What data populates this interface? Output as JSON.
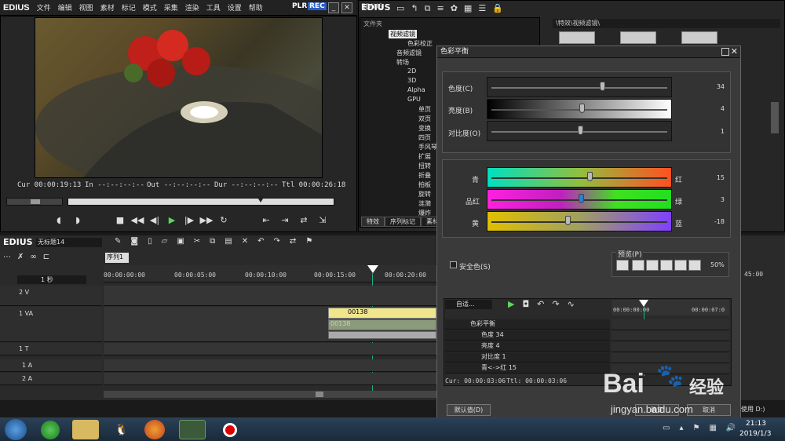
{
  "menubar": {
    "logo": "EDIUS",
    "items": [
      "文件",
      "编辑",
      "视图",
      "素材",
      "标记",
      "模式",
      "采集",
      "渲染",
      "工具",
      "设置",
      "帮助"
    ],
    "plr": "PLR",
    "rec": "REC"
  },
  "player": {
    "cur": "Cur 00:00:19:13",
    "in": "In --:--:--:--",
    "out": "Out --:--:--:--",
    "dur": "Dur --:--:--:--",
    "ttl": "Ttl 00:00:26:18"
  },
  "bin": {
    "logo": "EDIUS",
    "folder_label": "文件夹",
    "path": "\\特效\\视频滤镜\\",
    "tree": [
      "视频滤镜",
      "色彩校正",
      "音频滤镜",
      "转场",
      "2D",
      "3D",
      "Alpha",
      "GPU",
      "单页",
      "双页",
      "变换",
      "四页",
      "手风琴",
      "扩展",
      "扭转",
      "折叠",
      "拍板",
      "旋转",
      "涟漪",
      "爆炸"
    ],
    "tabs": [
      "特效",
      "序列标记",
      "素材"
    ]
  },
  "dialog": {
    "title": "色彩平衡",
    "chroma_label": "色度(C)",
    "chroma_value": "34",
    "brightness_label": "亮度(B)",
    "brightness_value": "4",
    "contrast_label": "对比度(O)",
    "contrast_value": "1",
    "cyan_label": "青",
    "red_label": "红",
    "cyan_red_value": "15",
    "magenta_label": "品红",
    "green_label": "绿",
    "magenta_green_value": "3",
    "yellow_label": "黄",
    "blue_label": "蓝",
    "yellow_blue_value": "-18",
    "safe_color_label": "安全色(S)",
    "preview_label": "预览(P)",
    "preview_zoom": "50%",
    "keyframe_mode": "自适...",
    "kf_rows": [
      "色彩平衡",
      "色度  34",
      "亮度  4",
      "对比度  1",
      "青<->红  15"
    ],
    "kf_cur": "Cur: 00:00:03:06",
    "kf_ttl": "Ttl: 00:00:03:06",
    "kf_time": "00:00:00:00",
    "kf_time2": "00:00:07:0",
    "default_button": "默认值(D)",
    "ok_button": "确定",
    "cancel_button": "取消"
  },
  "timeline": {
    "logo": "EDIUS",
    "project": "无标题14",
    "sequence_tab": "序列1",
    "scale": "1 秒",
    "ruler": [
      "00:00:00:00",
      "00:00:05:00",
      "00:00:10:00",
      "00:00:15:00",
      "00:00:20:00"
    ],
    "ruler_right": "45:00",
    "tracks": [
      "2 V",
      "1 VA",
      "1 T",
      "1 A",
      "2 A"
    ],
    "clip_name": "00138",
    "clip_name2": "00138"
  },
  "status": {
    "right": "使用 D:)"
  },
  "taskbar": {
    "time": "21:13",
    "date": "2019/1/3"
  },
  "watermark": {
    "brand": "Bai",
    "brand2": "经验",
    "url": "jingyan.baidu.com"
  }
}
